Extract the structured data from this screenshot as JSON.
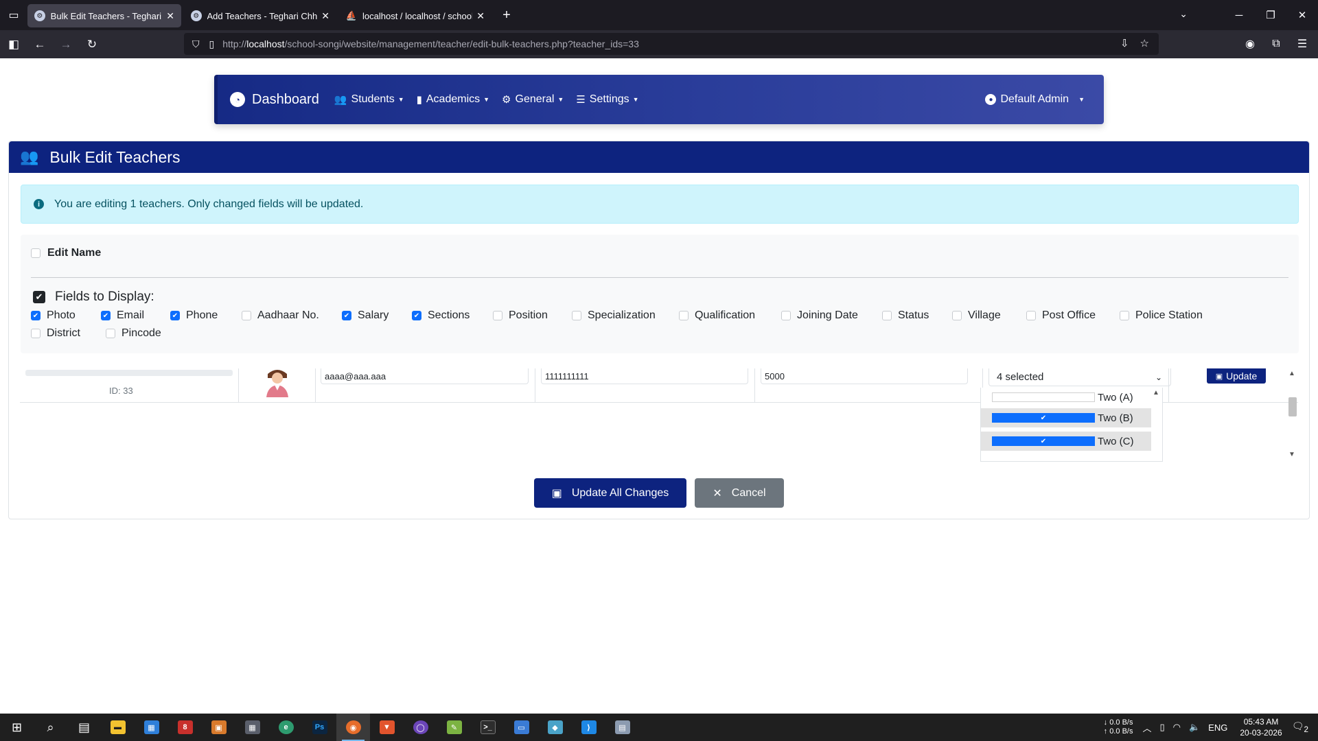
{
  "browser": {
    "tabs": [
      {
        "title": "Bulk Edit Teachers - Teghari Chh",
        "active": true
      },
      {
        "title": "Add Teachers - Teghari Chhaya",
        "active": false
      },
      {
        "title": "localhost / localhost / school_sy",
        "active": false
      }
    ],
    "url": {
      "lead": "http://",
      "host": "localhost",
      "path": "/school-songi/website/management/teacher/edit-bulk-teachers.php?teacher_ids=33"
    }
  },
  "app_nav": {
    "brand": "Dashboard",
    "menus": [
      {
        "label": "Students",
        "icon": "users-icon"
      },
      {
        "label": "Academics",
        "icon": "book-icon"
      },
      {
        "label": "General",
        "icon": "cogs-icon"
      },
      {
        "label": "Settings",
        "icon": "sliders-icon"
      }
    ],
    "user": "Default Admin"
  },
  "page": {
    "title": "Bulk Edit Teachers",
    "alert": "You are editing 1 teachers. Only changed fields will be updated.",
    "edit_name_label": "Edit Name",
    "edit_name_checked": false,
    "fields_title": "Fields to Display:",
    "fields": [
      {
        "label": "Photo",
        "checked": true
      },
      {
        "label": "Email",
        "checked": true
      },
      {
        "label": "Phone",
        "checked": true
      },
      {
        "label": "Aadhaar No.",
        "checked": false
      },
      {
        "label": "Salary",
        "checked": true
      },
      {
        "label": "Sections",
        "checked": true
      },
      {
        "label": "Position",
        "checked": false
      },
      {
        "label": "Specialization",
        "checked": false
      },
      {
        "label": "Qualification",
        "checked": false
      },
      {
        "label": "Joining Date",
        "checked": false
      },
      {
        "label": "Status",
        "checked": false
      },
      {
        "label": "Village",
        "checked": false
      },
      {
        "label": "Post Office",
        "checked": false
      },
      {
        "label": "Police Station",
        "checked": false
      },
      {
        "label": "District",
        "checked": false
      },
      {
        "label": "Pincode",
        "checked": false
      }
    ]
  },
  "row": {
    "id_text": "ID: 33",
    "email": "aaaa@aaa.aaa",
    "phone": "1111111111",
    "salary": "5000",
    "sections_summary": "4 selected",
    "update_label": "Update"
  },
  "sections_dropdown": [
    {
      "label": "Two (A)",
      "selected": false
    },
    {
      "label": "Two (B)",
      "selected": true
    },
    {
      "label": "Two (C)",
      "selected": true
    }
  ],
  "actions": {
    "update_all": "Update All Changes",
    "cancel": "Cancel"
  },
  "taskbar": {
    "net_down": "↓ 0.0 B/s",
    "net_up": "↑ 0.0 B/s",
    "lang": "ENG",
    "time": "05:43 AM",
    "date": "20-03-2026",
    "notifications": "2"
  }
}
